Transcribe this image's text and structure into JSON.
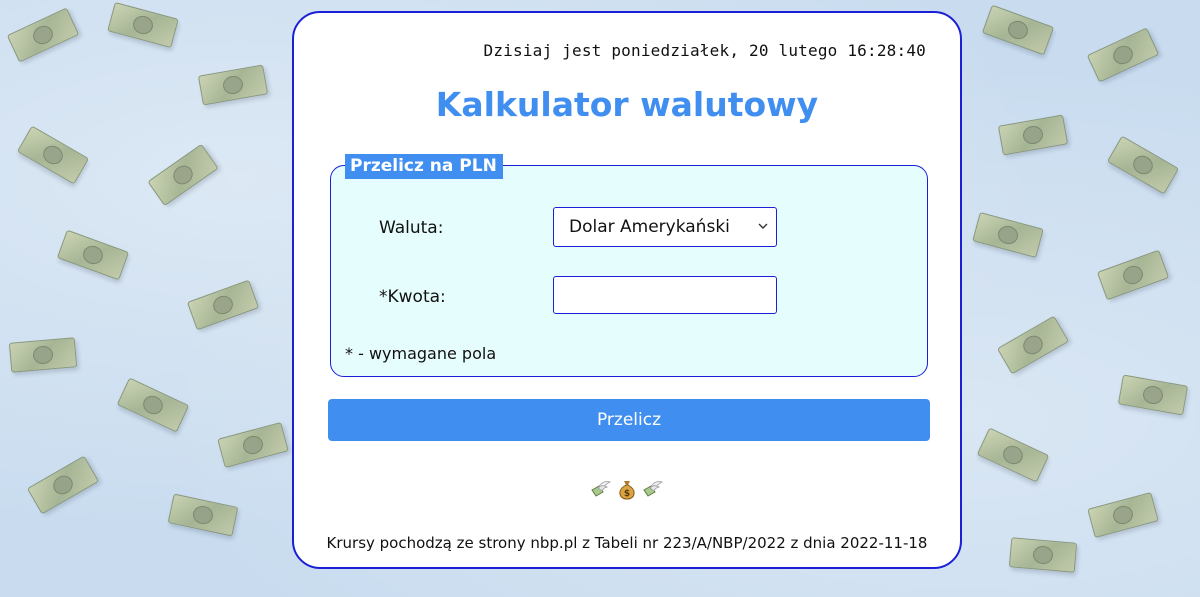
{
  "header": {
    "date_line": "Dzisiaj jest poniedziałek, 20 lutego 16:28:40"
  },
  "title": "Kalkulator walutowy",
  "form": {
    "legend": "Przelicz na PLN",
    "currency_label": "Waluta:",
    "currency_selected": "Dolar Amerykański",
    "amount_label": "*Kwota:",
    "amount_value": "",
    "required_note": "* - wymagane pola",
    "submit_label": "Przelicz"
  },
  "decoration": {
    "icons": [
      "money-with-wings-icon",
      "money-bag-icon",
      "money-with-wings-icon"
    ]
  },
  "footer": {
    "source_text": "Krursy pochodzą ze strony nbp.pl z Tabeli nr 223/A/NBP/2022 z dnia 2022-11-18"
  },
  "colors": {
    "accent": "#3f8ef0",
    "border": "#1b20d6",
    "fieldset_bg": "#e6fdfd",
    "page_bg": "#c9dcef"
  }
}
